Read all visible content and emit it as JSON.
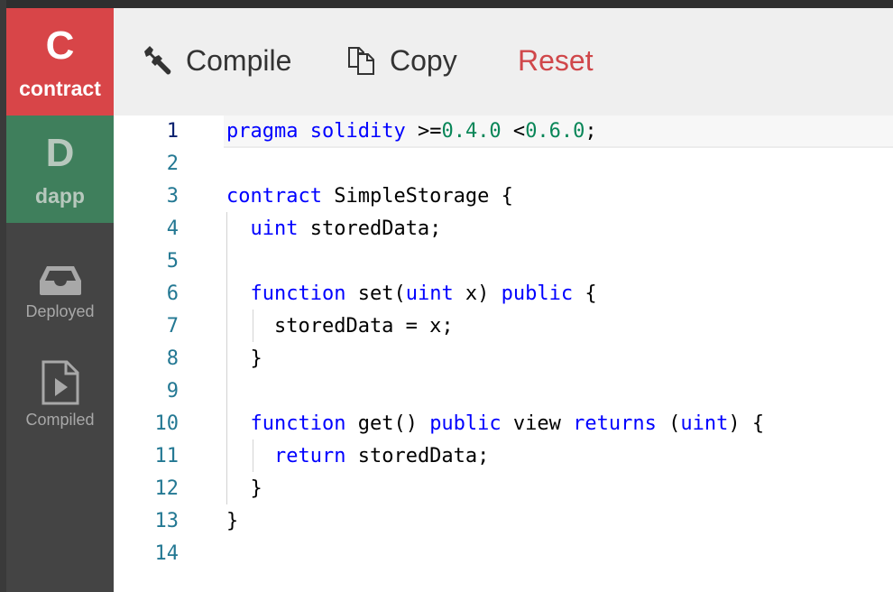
{
  "sidebar": {
    "contract": {
      "letter": "C",
      "label": "contract",
      "color": "#d84548"
    },
    "dapp": {
      "letter": "D",
      "label": "dapp",
      "color": "#3f7f5c"
    },
    "items": [
      {
        "label": "Deployed",
        "icon": "inbox-icon"
      },
      {
        "label": "Compiled",
        "icon": "file-play-icon"
      }
    ]
  },
  "toolbar": {
    "compile_label": "Compile",
    "copy_label": "Copy",
    "reset_label": "Reset",
    "reset_color": "#d0474a"
  },
  "editor": {
    "line_numbers": [
      "1",
      "2",
      "3",
      "4",
      "5",
      "6",
      "7",
      "8",
      "9",
      "10",
      "11",
      "12",
      "13",
      "14"
    ],
    "current_line": 1,
    "lines": [
      [
        {
          "t": "kw",
          "v": "pragma"
        },
        {
          "t": "p",
          "v": " "
        },
        {
          "t": "kw",
          "v": "solidity"
        },
        {
          "t": "p",
          "v": " >="
        },
        {
          "t": "num",
          "v": "0.4.0"
        },
        {
          "t": "p",
          "v": " <"
        },
        {
          "t": "num",
          "v": "0.6.0"
        },
        {
          "t": "p",
          "v": ";"
        }
      ],
      [],
      [
        {
          "t": "kw",
          "v": "contract"
        },
        {
          "t": "p",
          "v": " SimpleStorage {"
        }
      ],
      [
        {
          "t": "p",
          "v": "  "
        },
        {
          "t": "kw",
          "v": "uint"
        },
        {
          "t": "p",
          "v": " storedData;"
        }
      ],
      [],
      [
        {
          "t": "p",
          "v": "  "
        },
        {
          "t": "kw",
          "v": "function"
        },
        {
          "t": "p",
          "v": " set("
        },
        {
          "t": "kw",
          "v": "uint"
        },
        {
          "t": "p",
          "v": " x) "
        },
        {
          "t": "kw",
          "v": "public"
        },
        {
          "t": "p",
          "v": " {"
        }
      ],
      [
        {
          "t": "p",
          "v": "    storedData = x;"
        }
      ],
      [
        {
          "t": "p",
          "v": "  }"
        }
      ],
      [],
      [
        {
          "t": "p",
          "v": "  "
        },
        {
          "t": "kw",
          "v": "function"
        },
        {
          "t": "p",
          "v": " get() "
        },
        {
          "t": "kw",
          "v": "public"
        },
        {
          "t": "p",
          "v": " view "
        },
        {
          "t": "kw",
          "v": "returns"
        },
        {
          "t": "p",
          "v": " ("
        },
        {
          "t": "kw",
          "v": "uint"
        },
        {
          "t": "p",
          "v": ") {"
        }
      ],
      [
        {
          "t": "p",
          "v": "    "
        },
        {
          "t": "kw",
          "v": "return"
        },
        {
          "t": "p",
          "v": " storedData;"
        }
      ],
      [
        {
          "t": "p",
          "v": "  }"
        }
      ],
      [
        {
          "t": "p",
          "v": "}"
        }
      ],
      []
    ],
    "colors": {
      "keyword": "#0000ff",
      "number": "#098658",
      "line_number": "#237893"
    }
  }
}
